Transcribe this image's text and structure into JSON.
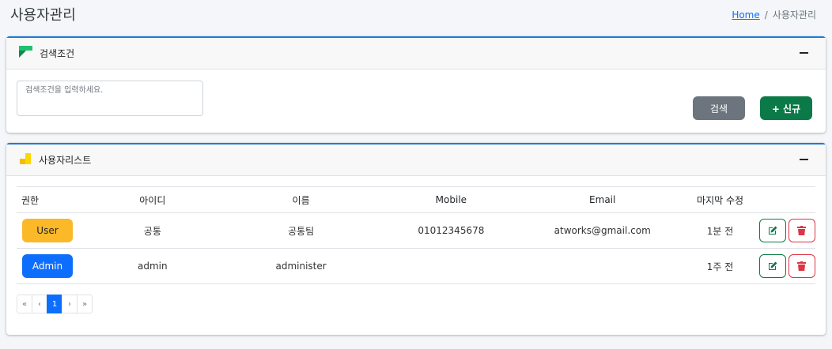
{
  "header": {
    "title": "사용자관리",
    "breadcrumb_home": "Home",
    "breadcrumb_separator": "/",
    "breadcrumb_current": "사용자관리"
  },
  "search_card": {
    "title": "검색조건",
    "icon": "form-icon",
    "collapse_icon": "minus-icon",
    "search_placeholder": "검색조건을 입력하세요.",
    "search_value": "",
    "search_button": "검색",
    "new_button": "+ 신규"
  },
  "list_card": {
    "title": "사용자리스트",
    "icon": "stairs-icon",
    "collapse_icon": "minus-icon",
    "columns": [
      "권한",
      "아이디",
      "이름",
      "Mobile",
      "Email",
      "마지막 수정"
    ],
    "rows": [
      {
        "role": "User",
        "id": "공통",
        "name": "공통팀",
        "mobile": "01012345678",
        "email": "atworks@gmail.com",
        "last_modified": "1분 전"
      },
      {
        "role": "Admin",
        "id": "admin",
        "name": "administer",
        "mobile": "",
        "email": "",
        "last_modified": "1주 전"
      }
    ],
    "pagination": [
      "«",
      "‹",
      "1",
      "›",
      "»"
    ],
    "current_page": "1"
  },
  "colors": {
    "accent": "#1f7ad8",
    "user_badge": "#fbb829",
    "admin_badge": "#0d6efd",
    "search_button": "#6c757d",
    "new_button": "#0b7a48",
    "edit": "#0b7a48",
    "delete": "#dc3545"
  }
}
